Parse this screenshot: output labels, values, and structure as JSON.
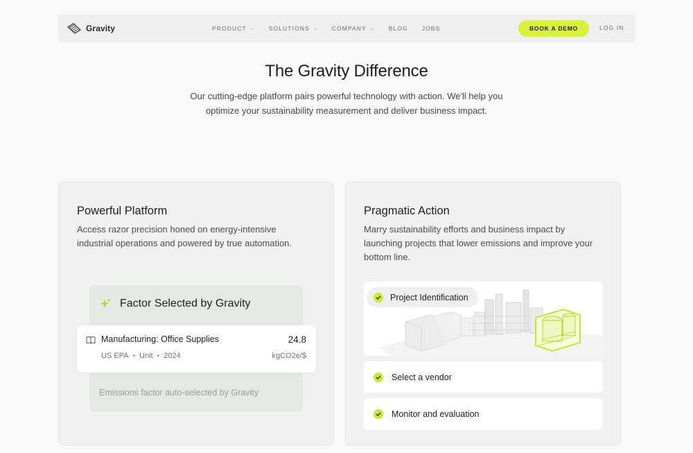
{
  "nav": {
    "brand": "Gravity",
    "links": [
      {
        "label": "PRODUCT",
        "has_dropdown": true
      },
      {
        "label": "SOLUTIONS",
        "has_dropdown": true
      },
      {
        "label": "COMPANY",
        "has_dropdown": true
      },
      {
        "label": "BLOG",
        "has_dropdown": false
      },
      {
        "label": "JOBS",
        "has_dropdown": false
      }
    ],
    "cta": "BOOK A DEMO",
    "login": "LOG IN"
  },
  "hero": {
    "title": "The Gravity Difference",
    "subtitle": "Our cutting-edge platform pairs powerful technology with action. We'll help you optimize your sustainability measurement and deliver business impact."
  },
  "platform_card": {
    "title": "Powerful Platform",
    "description": "Access razor precision honed on energy-intensive industrial operations and powered by true automation.",
    "panel_title": "Factor Selected by Gravity",
    "factor": {
      "name": "Manufacturing: Office Supplies",
      "value": "24.8",
      "source": "US EPA",
      "type": "Unit",
      "year": "2024",
      "unit": "kgCO2e/$"
    },
    "note": "Emissions factor auto-selected by Gravity"
  },
  "action_card": {
    "title": "Pragmatic Action",
    "description": "Marry sustainability efforts and business impact by launching projects that lower emissions and improve your bottom line.",
    "steps": [
      "Project Identification",
      "Select a vendor",
      "Monitor and evaluation"
    ]
  },
  "colors": {
    "accent": "#d8f13a",
    "check": "#cde63a",
    "background": "#f9f9f9",
    "card": "#f1f1f1"
  },
  "icons": [
    "gravity-logo-icon",
    "chevron-down-icon",
    "sparkle-icon",
    "book-icon",
    "check-icon",
    "industrial-plant-illustration"
  ]
}
